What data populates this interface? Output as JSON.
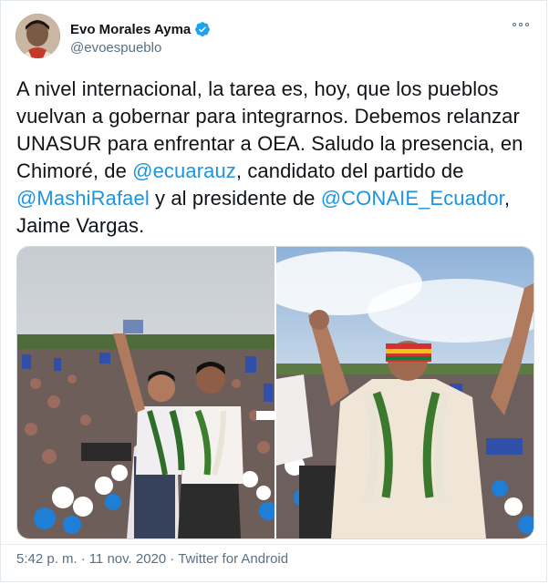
{
  "author": {
    "display_name": "Evo Morales Ayma",
    "handle": "@evoespueblo",
    "verified_icon": "verified-badge-icon",
    "avatar_icon": "profile-photo"
  },
  "tweet": {
    "parts": [
      {
        "type": "text",
        "value": "A nivel internacional, la tarea es, hoy, que los pueblos vuelvan a gobernar para integrarnos. Debemos relanzar UNASUR para enfrentar a OEA. Saludo la presencia, en Chimoré, de "
      },
      {
        "type": "mention",
        "value": "@ecuarauz"
      },
      {
        "type": "text",
        "value": ", candidato del partido de "
      },
      {
        "type": "mention",
        "value": "@MashiRafael"
      },
      {
        "type": "text",
        "value": " y al presidente de "
      },
      {
        "type": "mention",
        "value": "@CONAIE_Ecuador"
      },
      {
        "type": "text",
        "value": ", Jaime Vargas."
      }
    ]
  },
  "media": [
    {
      "name": "photo-1"
    },
    {
      "name": "photo-2"
    }
  ],
  "meta": {
    "time": "5:42 p. m.",
    "sep1": "·",
    "date": "11 nov. 2020",
    "sep2": "·",
    "source": "Twitter for Android"
  },
  "colors": {
    "link": "#1b95e0",
    "verified": "#1da1f2",
    "secondary_text": "#5b7083"
  }
}
